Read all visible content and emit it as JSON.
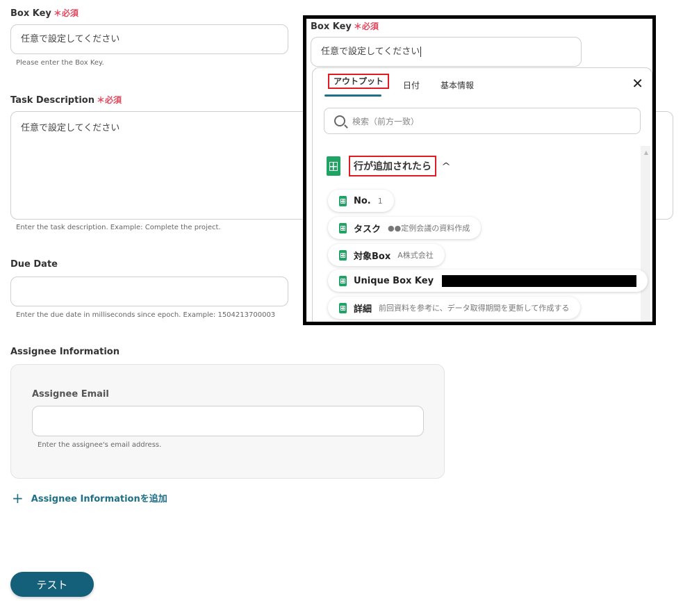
{
  "form": {
    "box_key": {
      "label": "Box Key",
      "required": "＊必須",
      "value": "任意で設定してください",
      "help": "Please enter the Box Key."
    },
    "task_description": {
      "label": "Task Description",
      "required": "＊必須",
      "value": "任意で設定してください",
      "help": "Enter the task description. Example: Complete the project."
    },
    "due_date": {
      "label": "Due Date",
      "value": "",
      "help": "Enter the due date in milliseconds since epoch. Example: 1504213700003"
    },
    "assignee_info": {
      "label": "Assignee Information",
      "email_label": "Assignee Email",
      "email_value": "",
      "email_help": "Enter the assignee's email address.",
      "add_label": "Assignee Informationを追加"
    },
    "test_button": "テスト"
  },
  "overlay": {
    "box_key_label": "Box Key",
    "required": "＊必須",
    "box_key_value": "任意で設定してください",
    "tabs": [
      "アウトプット",
      "日付",
      "基本情報"
    ],
    "active_tab": "アウトプット",
    "search_placeholder": "検索（前方一致）",
    "group_title": "行が追加されたら",
    "items": [
      {
        "name": "No.",
        "value": "1"
      },
      {
        "name": "タスク",
        "value": "●●定例会議の資料作成"
      },
      {
        "name": "対象Box",
        "value": "A株式会社"
      },
      {
        "name": "Unique Box Key",
        "value": ""
      },
      {
        "name": "詳細",
        "value": "前回資料を参考に、データ取得期間を更新して作成する"
      }
    ]
  },
  "colors": {
    "accent": "#1f6f87",
    "button": "#145f7a",
    "required": "#e04a5f",
    "highlight": "#e11b22",
    "sheets": "#1fa463"
  }
}
